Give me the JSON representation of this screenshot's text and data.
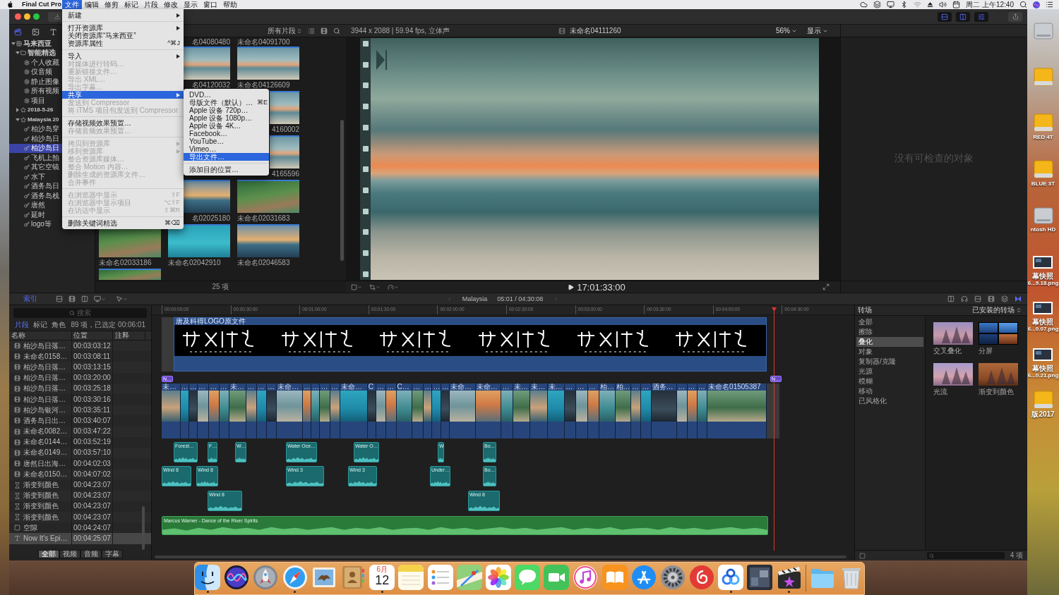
{
  "menu_bar": {
    "app_name": "Final Cut Pro",
    "menus": [
      {
        "label": "文件",
        "selected": true
      },
      {
        "label": "编辑",
        "selected": false
      },
      {
        "label": "修剪",
        "selected": false
      },
      {
        "label": "标记",
        "selected": false
      },
      {
        "label": "片段",
        "selected": false
      },
      {
        "label": "修改",
        "selected": false
      },
      {
        "label": "显示",
        "selected": false
      },
      {
        "label": "窗口",
        "selected": false
      },
      {
        "label": "帮助",
        "selected": false
      }
    ],
    "clock": "周二 上午12:40"
  },
  "file_menu": {
    "items": [
      {
        "kind": "item",
        "label": "新建",
        "submenu": true,
        "disabled": false,
        "selected": false
      },
      {
        "kind": "separator"
      },
      {
        "kind": "item",
        "label": "打开资源库",
        "submenu": true,
        "disabled": false,
        "selected": false
      },
      {
        "kind": "item",
        "label": "关闭资源库“马来西亚”",
        "submenu": false,
        "disabled": false,
        "selected": false
      },
      {
        "kind": "item",
        "label": "资源库属性",
        "shortcut": "^⌘J",
        "submenu": false,
        "disabled": false,
        "selected": false
      },
      {
        "kind": "separator"
      },
      {
        "kind": "item",
        "label": "导入",
        "submenu": true,
        "disabled": false,
        "selected": false
      },
      {
        "kind": "item",
        "label": "对媒体进行转码…",
        "submenu": false,
        "disabled": true,
        "selected": false
      },
      {
        "kind": "item",
        "label": "重新链接文件…",
        "submenu": false,
        "disabled": true,
        "selected": false
      },
      {
        "kind": "item",
        "label": "导出 XML…",
        "submenu": false,
        "disabled": true,
        "selected": false
      },
      {
        "kind": "item",
        "label": "导出字幕…",
        "submenu": false,
        "disabled": true,
        "selected": false
      },
      {
        "kind": "item",
        "label": "共享",
        "submenu": true,
        "disabled": false,
        "selected": true
      },
      {
        "kind": "item",
        "label": "发送到 Compressor",
        "submenu": false,
        "disabled": true,
        "selected": false
      },
      {
        "kind": "item",
        "label": "将 iTMS 项目包发送到 Compressor",
        "submenu": false,
        "disabled": true,
        "selected": false
      },
      {
        "kind": "separator"
      },
      {
        "kind": "item",
        "label": "存储视频效果预置…",
        "submenu": false,
        "disabled": false,
        "selected": false
      },
      {
        "kind": "item",
        "label": "存储音频效果预置…",
        "submenu": false,
        "disabled": true,
        "selected": false
      },
      {
        "kind": "separator"
      },
      {
        "kind": "item",
        "label": "拷贝到资源库",
        "submenu": true,
        "disabled": true,
        "selected": false
      },
      {
        "kind": "item",
        "label": "移到资源库",
        "submenu": true,
        "disabled": true,
        "selected": false
      },
      {
        "kind": "item",
        "label": "整合资源库媒体…",
        "submenu": false,
        "disabled": true,
        "selected": false
      },
      {
        "kind": "item",
        "label": "整合 Motion 内容…",
        "submenu": false,
        "disabled": true,
        "selected": false
      },
      {
        "kind": "item",
        "label": "删除生成的资源库文件…",
        "submenu": false,
        "disabled": true,
        "selected": false
      },
      {
        "kind": "item",
        "label": "合并事件",
        "submenu": false,
        "disabled": true,
        "selected": false
      },
      {
        "kind": "separator"
      },
      {
        "kind": "item",
        "label": "在浏览器中显示",
        "shortcut": "⇧F",
        "submenu": false,
        "disabled": true,
        "selected": false
      },
      {
        "kind": "item",
        "label": "在浏览器中显示项目",
        "shortcut": "⌥⇧F",
        "submenu": false,
        "disabled": true,
        "selected": false
      },
      {
        "kind": "item",
        "label": "在访达中显示",
        "shortcut": "⇧⌘R",
        "submenu": false,
        "disabled": true,
        "selected": false
      },
      {
        "kind": "separator"
      },
      {
        "kind": "item",
        "label": "删除关键词精选",
        "shortcut": "⌘⌫",
        "submenu": false,
        "disabled": false,
        "selected": false
      }
    ]
  },
  "share_menu": {
    "items": [
      {
        "kind": "item",
        "label": "DVD…",
        "selected": false
      },
      {
        "kind": "item",
        "label": "母版文件（默认）…",
        "shortcut": "⌘E",
        "selected": false
      },
      {
        "kind": "item",
        "label": "Apple 设备 720p…",
        "selected": false
      },
      {
        "kind": "item",
        "label": "Apple 设备 1080p…",
        "selected": false
      },
      {
        "kind": "item",
        "label": "Apple 设备 4K…",
        "selected": false
      },
      {
        "kind": "item",
        "label": "Facebook…",
        "selected": false
      },
      {
        "kind": "item",
        "label": "YouTube…",
        "selected": false
      },
      {
        "kind": "item",
        "label": "Vimeo…",
        "selected": false
      },
      {
        "kind": "item",
        "label": "导出文件…",
        "selected": true
      },
      {
        "kind": "separator"
      },
      {
        "kind": "item",
        "label": "添加目的位置…",
        "selected": false
      }
    ]
  },
  "library": {
    "items": [
      {
        "kind": "library",
        "label": "马来西亚",
        "expanded": true,
        "selected": false,
        "children": [
          {
            "kind": "folder",
            "label": "智能精选",
            "expanded": true,
            "selected": false,
            "children": [
              {
                "kind": "smart",
                "label": "个人收藏",
                "selected": false
              },
              {
                "kind": "smart",
                "label": "仅音频",
                "selected": false
              },
              {
                "kind": "smart",
                "label": "静止图像",
                "selected": false
              },
              {
                "kind": "smart",
                "label": "所有视频",
                "selected": false
              },
              {
                "kind": "smart",
                "label": "项目",
                "selected": false
              }
            ]
          },
          {
            "kind": "event",
            "label": "2018-5-26",
            "expanded": false,
            "selected": false
          },
          {
            "kind": "event",
            "label": "Malaysia 20",
            "expanded": true,
            "selected": false,
            "children": [
              {
                "kind": "keyword",
                "label": "柏沙岛穿",
                "selected": false
              },
              {
                "kind": "keyword",
                "label": "柏沙岛日",
                "selected": false
              },
              {
                "kind": "keyword",
                "label": "柏沙岛日",
                "selected": true
              },
              {
                "kind": "keyword",
                "label": "飞机上拍",
                "selected": false
              },
              {
                "kind": "keyword",
                "label": "其它空镜",
                "selected": false
              },
              {
                "kind": "keyword",
                "label": "水下",
                "selected": false
              },
              {
                "kind": "keyword",
                "label": "酒务岛日",
                "selected": false
              },
              {
                "kind": "keyword",
                "label": "酒务岛栈",
                "selected": false
              },
              {
                "kind": "keyword",
                "label": "唐然",
                "selected": false
              },
              {
                "kind": "keyword",
                "label": "延时",
                "selected": false
              },
              {
                "kind": "keyword",
                "label": "logo等",
                "selected": false
              }
            ]
          }
        ]
      }
    ]
  },
  "browser": {
    "filter": "所有片段",
    "top_labels": [
      "名04080480",
      "未命名04091700"
    ],
    "rows": [
      {
        "clips": [
          "名04120032",
          "未命名04126609"
        ]
      },
      {
        "clips": [
          "4160002"
        ]
      },
      {
        "clips": [
          "4165596"
        ]
      },
      {
        "clips": [
          "名02025180",
          "未命名02031683"
        ]
      },
      {
        "clips": [
          "未命名02033186",
          "未命名02042910",
          "未命名02046583"
        ]
      }
    ],
    "count": "25 项"
  },
  "viewer": {
    "info": "3944 x 2088 | 59.94 fps, 立体声",
    "clip_name": "未命名04111260",
    "zoom": "56%",
    "display_menu": "显示",
    "timecode": "17:01:33:00"
  },
  "inspector": {
    "message": "没有可检查的对象"
  },
  "timeline_bar": {
    "index_button": "索引",
    "project": "Malaysia",
    "timecode": "05:01 / 04:30:08"
  },
  "index": {
    "search": {
      "placeholder": "搜索"
    },
    "tabs": [
      {
        "label": "片段",
        "selected": true
      },
      {
        "label": "标记",
        "selected": false
      },
      {
        "label": "角色",
        "selected": false
      }
    ],
    "summary": "89 项，已选定 00:06:01",
    "columns": [
      "名称",
      "位置",
      "注释"
    ],
    "rows": [
      {
        "kind": "clip",
        "name": "柏沙岛日落…",
        "position": "00:03:03:12",
        "selected": false
      },
      {
        "kind": "clip",
        "name": "未命名0158…",
        "position": "00:03:08:11",
        "selected": false
      },
      {
        "kind": "clip",
        "name": "柏沙岛日落…",
        "position": "00:03:13:15",
        "selected": false
      },
      {
        "kind": "clip",
        "name": "柏沙岛日落…",
        "position": "00:03:20:00",
        "selected": false
      },
      {
        "kind": "clip",
        "name": "柏沙岛日落…",
        "position": "00:03:25:18",
        "selected": false
      },
      {
        "kind": "clip",
        "name": "柏沙岛日落…",
        "position": "00:03:30:16",
        "selected": false
      },
      {
        "kind": "clip",
        "name": "柏沙岛银河…",
        "position": "00:03:35:11",
        "selected": false
      },
      {
        "kind": "clip",
        "name": "酒务岛日出…",
        "position": "00:03:40:07",
        "selected": false
      },
      {
        "kind": "clip",
        "name": "未命名0082…",
        "position": "00:03:47:22",
        "selected": false
      },
      {
        "kind": "clip",
        "name": "未命名0144…",
        "position": "00:03:52:19",
        "selected": false
      },
      {
        "kind": "clip",
        "name": "未命名0149…",
        "position": "00:03:57:10",
        "selected": false
      },
      {
        "kind": "clip",
        "name": "唐然日出海…",
        "position": "00:04:02:03",
        "selected": false
      },
      {
        "kind": "clip",
        "name": "未命名0150…",
        "position": "00:04:07:02",
        "selected": false
      },
      {
        "kind": "transition",
        "name": "渐变到颜色",
        "position": "00:04:23:07",
        "selected": false
      },
      {
        "kind": "transition",
        "name": "渐变到颜色",
        "position": "00:04:23:07",
        "selected": false
      },
      {
        "kind": "transition",
        "name": "渐变到颜色",
        "position": "00:04:23:07",
        "selected": false
      },
      {
        "kind": "transition",
        "name": "渐变到颜色",
        "position": "00:04:23:07",
        "selected": false
      },
      {
        "kind": "gap",
        "name": "空隙",
        "position": "00:04:24:07",
        "selected": false
      },
      {
        "kind": "title",
        "name": "Now It's Epi…",
        "position": "00:04:25:07",
        "selected": true
      }
    ],
    "filters": [
      {
        "label": "全部",
        "selected": true
      },
      {
        "label": "视频",
        "selected": false
      },
      {
        "label": "音频",
        "selected": false
      },
      {
        "label": "字幕",
        "selected": false
      }
    ]
  },
  "timeline": {
    "ruler": [
      "00:00:00:00",
      "00:00:30:00",
      "00:01:00:00",
      "00:01:30:00",
      "00:02:00:00",
      "00:02:30:00",
      "00:03:00:00",
      "00:03:30:00",
      "00:04:00:00",
      "00:04:30:00"
    ],
    "title_clip": {
      "label": "唐及科得LOGO原文件"
    },
    "markers": [
      {
        "label": "N…"
      },
      {
        "label": "N…"
      }
    ],
    "storyline": [
      {
        "label": "未…"
      },
      {
        "label": "…"
      },
      {
        "label": "…"
      },
      {
        "label": "…"
      },
      {
        "label": "…"
      },
      {
        "label": "…"
      },
      {
        "label": "未…"
      },
      {
        "label": "…"
      },
      {
        "label": "…"
      },
      {
        "label": "…"
      },
      {
        "label": "未命…"
      },
      {
        "label": "…"
      },
      {
        "label": "…"
      },
      {
        "label": "…"
      },
      {
        "label": "…"
      },
      {
        "label": "未命…"
      },
      {
        "label": "C"
      },
      {
        "label": "…"
      },
      {
        "label": "…"
      },
      {
        "label": "C…"
      },
      {
        "label": "…"
      },
      {
        "label": "…"
      },
      {
        "label": "…"
      },
      {
        "label": "…"
      },
      {
        "label": "未命…"
      },
      {
        "label": "未命…"
      },
      {
        "label": "…"
      },
      {
        "label": "未…"
      },
      {
        "label": "未…"
      },
      {
        "label": "未…"
      },
      {
        "label": "…"
      },
      {
        "label": "…"
      },
      {
        "label": "…"
      },
      {
        "label": "柏…"
      },
      {
        "label": "柏…"
      },
      {
        "label": "…"
      },
      {
        "label": "…"
      },
      {
        "label": "酒务…"
      },
      {
        "label": "…"
      },
      {
        "label": "…"
      },
      {
        "label": "…"
      },
      {
        "label": "未命名01505387"
      }
    ],
    "audio_clips": [
      {
        "label": "Forest…"
      },
      {
        "label": "F…"
      },
      {
        "label": "W…"
      },
      {
        "label": "Water Oce…"
      },
      {
        "label": "Water O…"
      },
      {
        "label": "W"
      },
      {
        "label": "Bo…"
      },
      {
        "label": "Wind 8"
      },
      {
        "label": "Wind 8"
      },
      {
        "label": "Wind 3"
      },
      {
        "label": "Wind 3"
      },
      {
        "label": "Under…"
      },
      {
        "label": "Bo…"
      },
      {
        "label": "Wind 8"
      },
      {
        "label": "Wind 8"
      }
    ],
    "music": {
      "label": "Marcus Warner - Dance of the River Spirits"
    }
  },
  "transitions": {
    "title": "转场",
    "source": "已安装的转场",
    "categories": [
      {
        "label": "全部",
        "selected": false
      },
      {
        "label": "擦除",
        "selected": false
      },
      {
        "label": "叠化",
        "selected": true
      },
      {
        "label": "对象",
        "selected": false
      },
      {
        "label": "复制器/克隆",
        "selected": false
      },
      {
        "label": "光源",
        "selected": false
      },
      {
        "label": "模糊",
        "selected": false
      },
      {
        "label": "移动",
        "selected": false
      },
      {
        "label": "已风格化",
        "selected": false
      }
    ],
    "items": [
      {
        "kind": "dissolve",
        "label": "交叉叠化"
      },
      {
        "kind": "split",
        "label": "分屏"
      },
      {
        "kind": "flow",
        "label": "光流"
      },
      {
        "kind": "fade",
        "label": "渐变到颜色"
      }
    ],
    "count": "4 项"
  },
  "desktop": {
    "icons": [
      {
        "kind": "internal"
      },
      {
        "kind": "external"
      },
      {
        "kind": "external",
        "lines": [
          "RED 4T"
        ]
      },
      {
        "kind": "external",
        "lines": [
          "BLUE 3T"
        ]
      },
      {
        "kind": "internal",
        "lines": [
          "ntosh HD"
        ]
      },
      {
        "kind": "screenshot",
        "lines": [
          "幕快照",
          "6...9.18.png"
        ]
      },
      {
        "kind": "screenshot",
        "lines": [
          "幕快照",
          "6...0.07.png"
        ]
      },
      {
        "kind": "screenshot",
        "lines": [
          "幕快照",
          "6...0.21.png"
        ]
      },
      {
        "kind": "external",
        "lines": [
          "版2017"
        ]
      }
    ]
  },
  "dock": {
    "apps": [
      {
        "kind": "finder",
        "running": true
      },
      {
        "kind": "siri",
        "running": false
      },
      {
        "kind": "launchpad",
        "running": false
      },
      {
        "kind": "safari",
        "running": true
      },
      {
        "kind": "mail",
        "running": false
      },
      {
        "kind": "contacts",
        "running": false
      },
      {
        "kind": "calendar",
        "month": "6月",
        "day": "12",
        "running": true
      },
      {
        "kind": "notes",
        "running": false
      },
      {
        "kind": "reminders",
        "running": false
      },
      {
        "kind": "maps",
        "running": false
      },
      {
        "kind": "photos",
        "running": false
      },
      {
        "kind": "messages",
        "running": false
      },
      {
        "kind": "facetime",
        "running": false
      },
      {
        "kind": "itunes",
        "running": false
      },
      {
        "kind": "ibooks",
        "running": false
      },
      {
        "kind": "appstore",
        "running": false
      },
      {
        "kind": "settings",
        "running": false
      },
      {
        "kind": "netease",
        "running": false
      },
      {
        "kind": "baidu",
        "running": true
      },
      {
        "kind": "lightroom",
        "running": false
      },
      {
        "kind": "fcp",
        "running": true
      },
      {
        "kind": "separator"
      },
      {
        "kind": "downloads",
        "running": false
      },
      {
        "kind": "trash",
        "running": false
      }
    ]
  }
}
